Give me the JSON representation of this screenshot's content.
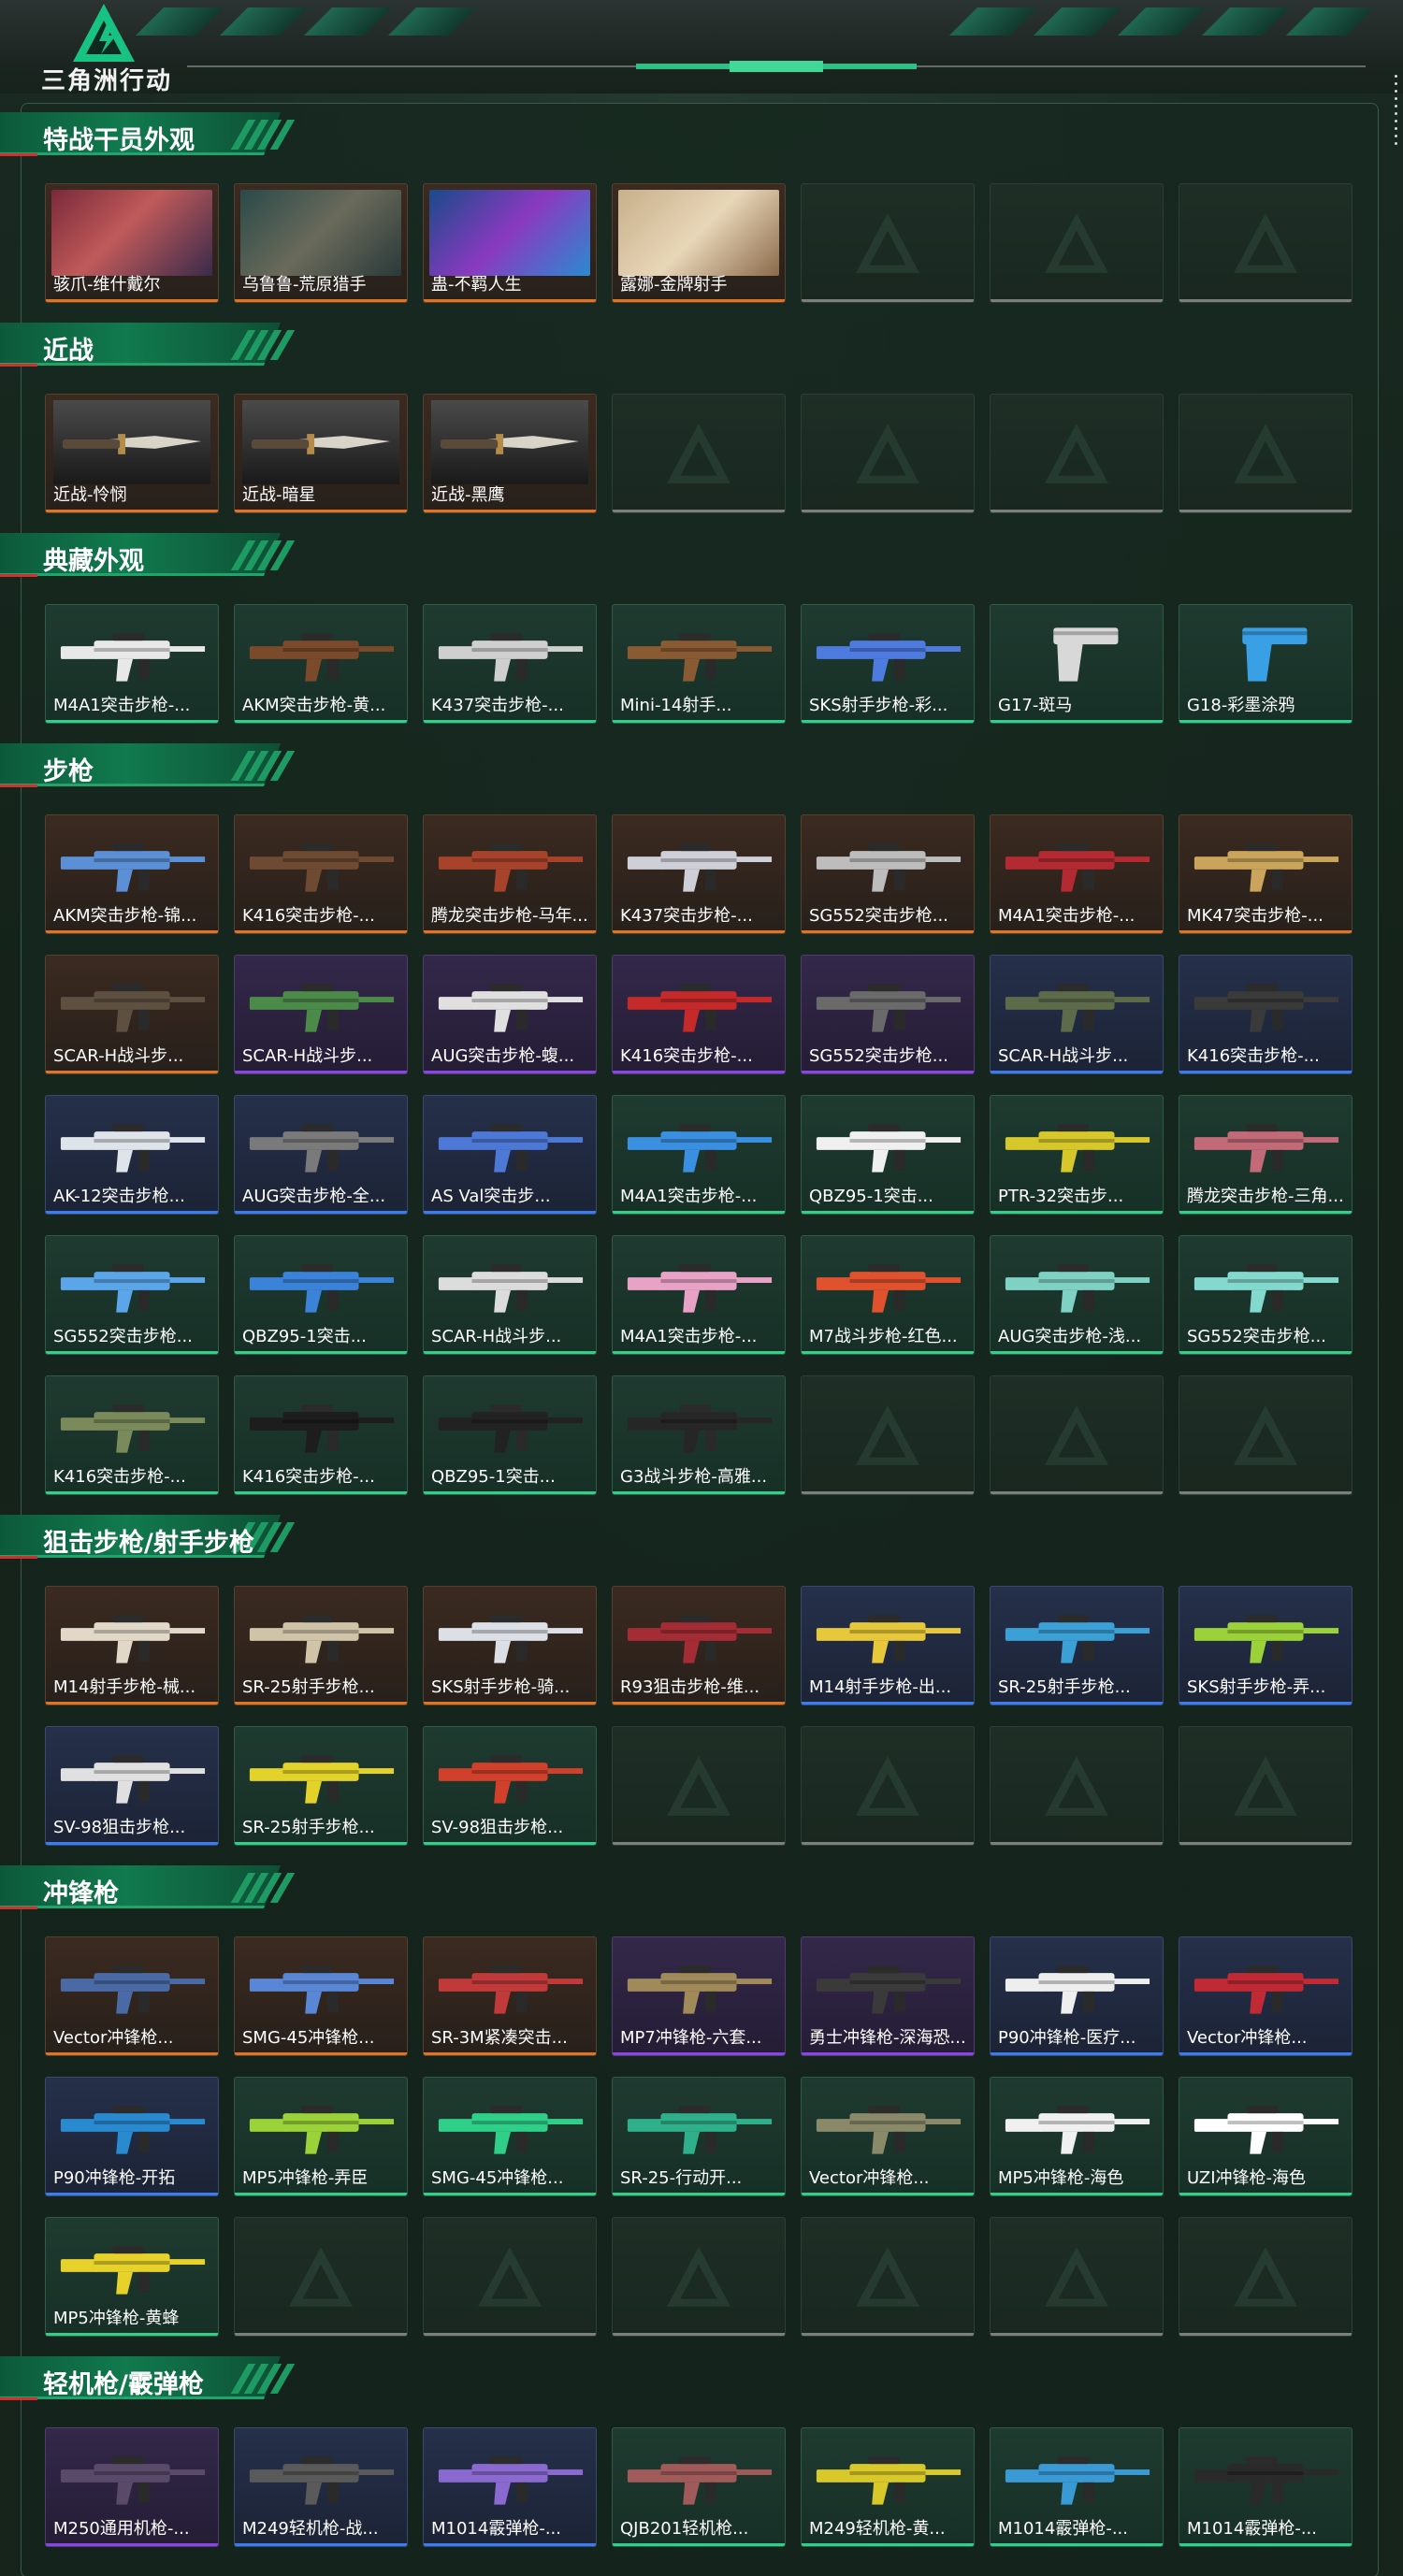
{
  "brand": {
    "name": "三角洲行动",
    "accent": "#1fa56b",
    "logo_icon": "delta-triangle-logo-icon"
  },
  "rarity_colors": {
    "orange": "#e07422",
    "green": "#2fd08a",
    "blue": "#3b7cf2",
    "purple": "#8a45e6",
    "red": "#e23b3b",
    "empty": "#7c7f7d"
  },
  "sections": [
    {
      "id": "operators",
      "title": "特战干员外观",
      "rows": [
        [
          {
            "label": "骇爪-维什戴尔",
            "rarity": "orange",
            "kind": "photo-red"
          },
          {
            "label": "乌鲁鲁-荒原猎手",
            "rarity": "orange",
            "kind": "photo-teal"
          },
          {
            "label": "蛊-不羁人生",
            "rarity": "orange",
            "kind": "photo-blue"
          },
          {
            "label": "露娜-金牌射手",
            "rarity": "orange",
            "kind": "photo-sand"
          },
          {
            "label": "",
            "rarity": "empty"
          },
          {
            "label": "",
            "rarity": "empty"
          },
          {
            "label": "",
            "rarity": "empty"
          }
        ]
      ]
    },
    {
      "id": "melee",
      "title": "近战",
      "rows": [
        [
          {
            "label": "近战-怜悯",
            "rarity": "orange",
            "kind": "knife"
          },
          {
            "label": "近战-暗星",
            "rarity": "orange",
            "kind": "knife"
          },
          {
            "label": "近战-黑鹰",
            "rarity": "orange",
            "kind": "knife"
          },
          {
            "label": "",
            "rarity": "empty"
          },
          {
            "label": "",
            "rarity": "empty"
          },
          {
            "label": "",
            "rarity": "empty"
          },
          {
            "label": "",
            "rarity": "empty"
          }
        ]
      ]
    },
    {
      "id": "collection",
      "title": "典藏外观",
      "rows": [
        [
          {
            "label": "M4A1突击步枪-...",
            "rarity": "green",
            "kind": "gun",
            "color": "#e8e8e8"
          },
          {
            "label": "AKM突击步枪-黄...",
            "rarity": "green",
            "kind": "gun",
            "color": "#7a4a2a"
          },
          {
            "label": "K437突击步枪-...",
            "rarity": "green",
            "kind": "gun",
            "color": "#cfcfcf"
          },
          {
            "label": "Mini-14射手...",
            "rarity": "green",
            "kind": "gun",
            "color": "#8a5a32"
          },
          {
            "label": "SKS射手步枪-彩...",
            "rarity": "green",
            "kind": "gun",
            "color": "#4d7be0"
          },
          {
            "label": "G17-斑马",
            "rarity": "green",
            "kind": "pistol",
            "color": "#d8d8d8"
          },
          {
            "label": "G18-彩墨涂鸦",
            "rarity": "green",
            "kind": "pistol",
            "color": "#3aa0e6"
          }
        ]
      ]
    },
    {
      "id": "rifles",
      "title": "步枪",
      "rows": [
        [
          {
            "label": "AKM突击步枪-锦...",
            "rarity": "orange",
            "kind": "gun",
            "color": "#5b8fd6"
          },
          {
            "label": "K416突击步枪-...",
            "rarity": "orange",
            "kind": "gun",
            "color": "#6e4a33"
          },
          {
            "label": "腾龙突击步枪-马年...",
            "rarity": "orange",
            "kind": "gun",
            "color": "#a8432b"
          },
          {
            "label": "K437突击步枪-...",
            "rarity": "orange",
            "kind": "gun",
            "color": "#cfcfd8"
          },
          {
            "label": "SG552突击步枪...",
            "rarity": "orange",
            "kind": "gun",
            "color": "#bdbdbd"
          },
          {
            "label": "M4A1突击步枪-...",
            "rarity": "orange",
            "kind": "gun",
            "color": "#b32a32"
          },
          {
            "label": "MK47突击步枪-...",
            "rarity": "orange",
            "kind": "gun",
            "color": "#c9a45a"
          }
        ],
        [
          {
            "label": "SCAR-H战斗步...",
            "rarity": "orange",
            "kind": "gun",
            "color": "#5e5040"
          },
          {
            "label": "SCAR-H战斗步...",
            "rarity": "purple",
            "kind": "gun",
            "color": "#4c8a4a"
          },
          {
            "label": "AUG突击步枪-蝮...",
            "rarity": "purple",
            "kind": "gun",
            "color": "#e0e0e0"
          },
          {
            "label": "K416突击步枪-...",
            "rarity": "purple",
            "kind": "gun",
            "color": "#c42a2a"
          },
          {
            "label": "SG552突击步枪...",
            "rarity": "purple",
            "kind": "gun",
            "color": "#6a6a6a"
          },
          {
            "label": "SCAR-H战斗步...",
            "rarity": "blue",
            "kind": "gun",
            "color": "#5d6b4a"
          },
          {
            "label": "K416突击步枪-...",
            "rarity": "blue",
            "kind": "gun",
            "color": "#3a3a3a"
          }
        ],
        [
          {
            "label": "AK-12突击步枪...",
            "rarity": "blue",
            "kind": "gun",
            "color": "#dfe3ea"
          },
          {
            "label": "AUG突击步枪-全...",
            "rarity": "blue",
            "kind": "gun",
            "color": "#7a7a7a"
          },
          {
            "label": "AS Val突击步...",
            "rarity": "blue",
            "kind": "gun",
            "color": "#4d78d6"
          },
          {
            "label": "M4A1突击步枪-...",
            "rarity": "green",
            "kind": "gun",
            "color": "#3a8fe0"
          },
          {
            "label": "QBZ95-1突击...",
            "rarity": "green",
            "kind": "gun",
            "color": "#f0f0f0"
          },
          {
            "label": "PTR-32突击步...",
            "rarity": "green",
            "kind": "gun",
            "color": "#d6c72a"
          },
          {
            "label": "腾龙突击步枪-三角...",
            "rarity": "green",
            "kind": "gun",
            "color": "#c26a78"
          }
        ],
        [
          {
            "label": "SG552突击步枪...",
            "rarity": "green",
            "kind": "gun",
            "color": "#5aa6e8"
          },
          {
            "label": "QBZ95-1突击...",
            "rarity": "green",
            "kind": "gun",
            "color": "#3b82d9"
          },
          {
            "label": "SCAR-H战斗步...",
            "rarity": "green",
            "kind": "gun",
            "color": "#dcdcdc"
          },
          {
            "label": "M4A1突击步枪-...",
            "rarity": "green",
            "kind": "gun",
            "color": "#e8a2c6"
          },
          {
            "label": "M7战斗步枪-红色...",
            "rarity": "green",
            "kind": "gun",
            "color": "#e0512e"
          },
          {
            "label": "AUG突击步枪-浅...",
            "rarity": "green",
            "kind": "gun",
            "color": "#7fd1c3"
          },
          {
            "label": "SG552突击步枪...",
            "rarity": "green",
            "kind": "gun",
            "color": "#84d9cf"
          }
        ],
        [
          {
            "label": "K416突击步枪-...",
            "rarity": "green",
            "kind": "gun",
            "color": "#7a8a5a"
          },
          {
            "label": "K416突击步枪-...",
            "rarity": "green",
            "kind": "gun",
            "color": "#1d1d1d"
          },
          {
            "label": "QBZ95-1突击...",
            "rarity": "green",
            "kind": "gun",
            "color": "#222"
          },
          {
            "label": "G3战斗步枪-高雅...",
            "rarity": "green",
            "kind": "gun",
            "color": "#262626"
          },
          {
            "label": "",
            "rarity": "empty"
          },
          {
            "label": "",
            "rarity": "empty"
          },
          {
            "label": "",
            "rarity": "empty"
          }
        ]
      ]
    },
    {
      "id": "snipers",
      "title": "狙击步枪/射手步枪",
      "rows": [
        [
          {
            "label": "M14射手步枪-械...",
            "rarity": "orange",
            "kind": "gun",
            "color": "#e2d8c8"
          },
          {
            "label": "SR-25射手步枪...",
            "rarity": "orange",
            "kind": "gun",
            "color": "#cfc3a8"
          },
          {
            "label": "SKS射手步枪-骑...",
            "rarity": "orange",
            "kind": "gun",
            "color": "#dcdfe6"
          },
          {
            "label": "R93狙击步枪-维...",
            "rarity": "orange",
            "kind": "gun",
            "color": "#a32c35"
          },
          {
            "label": "M14射手步枪-出...",
            "rarity": "blue",
            "kind": "gun",
            "color": "#e6c83a"
          },
          {
            "label": "SR-25射手步枪...",
            "rarity": "blue",
            "kind": "gun",
            "color": "#3aa0d6"
          },
          {
            "label": "SKS射手步枪-弄...",
            "rarity": "blue",
            "kind": "gun",
            "color": "#9bd23a"
          }
        ],
        [
          {
            "label": "SV-98狙击步枪...",
            "rarity": "blue",
            "kind": "gun",
            "color": "#e0e0e0"
          },
          {
            "label": "SR-25射手步枪...",
            "rarity": "green",
            "kind": "gun",
            "color": "#e2d22a"
          },
          {
            "label": "SV-98狙击步枪...",
            "rarity": "green",
            "kind": "gun",
            "color": "#d0402a"
          },
          {
            "label": "",
            "rarity": "empty"
          },
          {
            "label": "",
            "rarity": "empty"
          },
          {
            "label": "",
            "rarity": "empty"
          },
          {
            "label": "",
            "rarity": "empty"
          }
        ]
      ]
    },
    {
      "id": "smgs",
      "title": "冲锋枪",
      "rows": [
        [
          {
            "label": "Vector冲锋枪...",
            "rarity": "orange",
            "kind": "gun",
            "color": "#4a6aa6"
          },
          {
            "label": "SMG-45冲锋枪...",
            "rarity": "orange",
            "kind": "gun",
            "color": "#5a86d6"
          },
          {
            "label": "SR-3M紧凑突击...",
            "rarity": "orange",
            "kind": "gun",
            "color": "#c03a3a"
          },
          {
            "label": "MP7冲锋枪-六套...",
            "rarity": "purple",
            "kind": "gun",
            "color": "#a08a5a"
          },
          {
            "label": "勇士冲锋枪-深海恐...",
            "rarity": "purple",
            "kind": "gun",
            "color": "#3a3a3a"
          },
          {
            "label": "P90冲锋枪-医疗...",
            "rarity": "blue",
            "kind": "gun",
            "color": "#eeeeee"
          },
          {
            "label": "Vector冲锋枪...",
            "rarity": "blue",
            "kind": "gun",
            "color": "#c02a35"
          }
        ],
        [
          {
            "label": "P90冲锋枪-开拓",
            "rarity": "blue",
            "kind": "gun",
            "color": "#2a8ad0"
          },
          {
            "label": "MP5冲锋枪-弄臣",
            "rarity": "green",
            "kind": "gun",
            "color": "#9bd23a"
          },
          {
            "label": "SMG-45冲锋枪...",
            "rarity": "green",
            "kind": "gun",
            "color": "#2fcf8a"
          },
          {
            "label": "SR-25-行动开...",
            "rarity": "green",
            "kind": "gun",
            "color": "#2fb08a"
          },
          {
            "label": "Vector冲锋枪...",
            "rarity": "green",
            "kind": "gun",
            "color": "#8a8a6a"
          },
          {
            "label": "MP5冲锋枪-海色",
            "rarity": "green",
            "kind": "gun",
            "color": "#f0f0f0"
          },
          {
            "label": "UZI冲锋枪-海色",
            "rarity": "green",
            "kind": "gun",
            "color": "#ffffff"
          }
        ],
        [
          {
            "label": "MP5冲锋枪-黄蜂",
            "rarity": "green",
            "kind": "gun",
            "color": "#e6d22a"
          },
          {
            "label": "",
            "rarity": "empty"
          },
          {
            "label": "",
            "rarity": "empty"
          },
          {
            "label": "",
            "rarity": "empty"
          },
          {
            "label": "",
            "rarity": "empty"
          },
          {
            "label": "",
            "rarity": "empty"
          },
          {
            "label": "",
            "rarity": "empty"
          }
        ]
      ]
    },
    {
      "id": "lmg-shotguns",
      "title": "轻机枪/霰弹枪",
      "rows": [
        [
          {
            "label": "M250通用机枪-...",
            "rarity": "purple",
            "kind": "gun",
            "color": "#5a4a6a"
          },
          {
            "label": "M249轻机枪-战...",
            "rarity": "blue",
            "kind": "gun",
            "color": "#5a5a5a"
          },
          {
            "label": "M1014霰弹枪-...",
            "rarity": "blue",
            "kind": "gun",
            "color": "#8a6ad0"
          },
          {
            "label": "QJB201轻机枪...",
            "rarity": "green",
            "kind": "gun",
            "color": "#a05a5a"
          },
          {
            "label": "M249轻机枪-黄...",
            "rarity": "green",
            "kind": "gun",
            "color": "#d8c82a"
          },
          {
            "label": "M1014霰弹枪-...",
            "rarity": "green",
            "kind": "gun",
            "color": "#3a9ad6"
          },
          {
            "label": "M1014霰弹枪-...",
            "rarity": "green",
            "kind": "gun",
            "color": "#2a2a2a"
          }
        ]
      ]
    }
  ]
}
